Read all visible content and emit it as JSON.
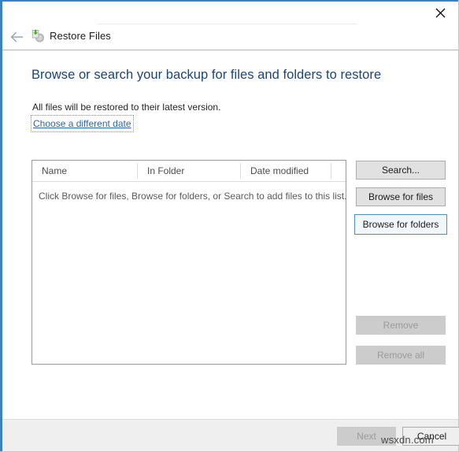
{
  "window": {
    "title": "Restore Files",
    "close_label": "✕",
    "accent_color": "#3b83bd"
  },
  "nav": {
    "back_label": "←",
    "app_icon": "restore-files-icon",
    "title": "Restore Files"
  },
  "main": {
    "heading": "Browse or search your backup for files and folders to restore",
    "subtext": "All files will be restored to their latest version.",
    "link_label": "Choose a different date"
  },
  "list": {
    "columns": [
      {
        "label": "Name"
      },
      {
        "label": "In Folder"
      },
      {
        "label": "Date modified"
      },
      {
        "label": ""
      }
    ],
    "empty_message": "Click Browse for files, Browse for folders, or Search to add files to this list.",
    "rows": []
  },
  "side_buttons": [
    {
      "label": "Search...",
      "state": "normal"
    },
    {
      "label": "Browse for files",
      "state": "normal"
    },
    {
      "label": "Browse for folders",
      "state": "focused"
    },
    {
      "label": "Remove",
      "state": "disabled"
    },
    {
      "label": "Remove all",
      "state": "disabled"
    }
  ],
  "footer": {
    "next_label": "Next",
    "next_state": "disabled",
    "cancel_label": "Cancel",
    "cancel_state": "normal"
  },
  "watermark": "wsxdn.com"
}
